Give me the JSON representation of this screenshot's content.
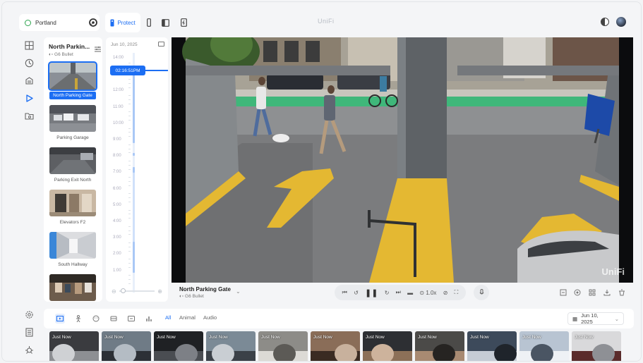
{
  "topbar": {
    "site": "Portland",
    "app_tab": "Protect",
    "brand": "UniFi"
  },
  "camera_panel": {
    "selected_name": "North Parkin...",
    "selected_model": "G6 Bullet",
    "cameras": [
      {
        "label": "North Parking Gate",
        "active": true
      },
      {
        "label": "Parking Garage",
        "active": false
      },
      {
        "label": "Parking Exit North",
        "active": false
      },
      {
        "label": "Elevators F2",
        "active": false
      },
      {
        "label": "South Hallway",
        "active": false
      },
      {
        "label": "",
        "active": false
      }
    ]
  },
  "timeline": {
    "date": "Jun 10, 2025",
    "current_time": "02:16:51PM",
    "ticks": [
      "14:00",
      "13:00",
      "12:00",
      "11:00",
      "10:00",
      "9:00",
      "8:00",
      "7:00",
      "6:00",
      "5:00",
      "4:00",
      "3:00",
      "2:00",
      "1:00"
    ]
  },
  "player": {
    "camera_name": "North Parking Gate",
    "camera_model": "G6 Bullet",
    "speed": "1.0x",
    "watermark": "UniFi"
  },
  "detections": {
    "chips": [
      {
        "label": "All",
        "active": true
      },
      {
        "label": "Animal",
        "active": false
      },
      {
        "label": "Audio",
        "active": false
      }
    ],
    "date": "Jun 10, 2025",
    "thumbnails": [
      "Just Now",
      "Just Now",
      "Just Now",
      "Just Now",
      "Just Now",
      "Just Now",
      "Just Now",
      "Just Now",
      "Just Now",
      "Just Now",
      "Just Now"
    ]
  },
  "colors": {
    "accent": "#1c6ef3",
    "parking_yellow": "#e4b832",
    "bike_lane_green": "#3fb77a"
  }
}
